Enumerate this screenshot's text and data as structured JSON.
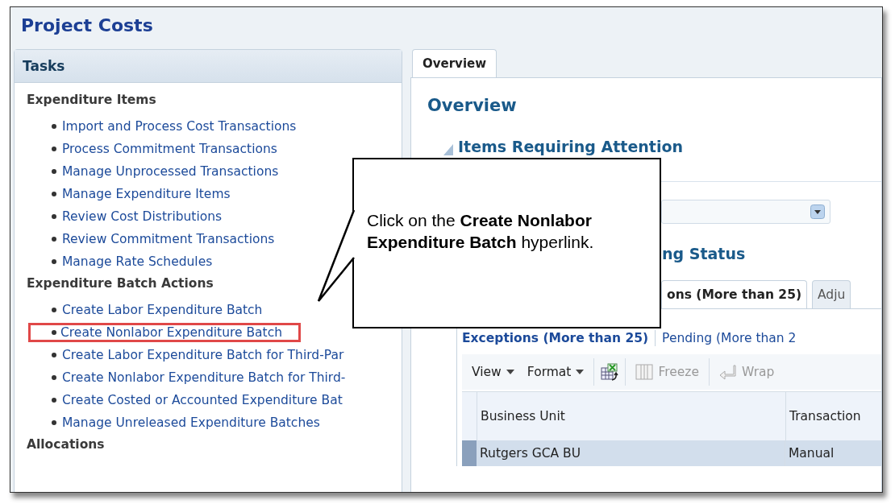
{
  "page_title": "Project Costs",
  "tasks_panel": {
    "title": "Tasks",
    "sections": [
      {
        "heading": "Expenditure Items",
        "links": [
          {
            "label": "Import and Process Cost Transactions",
            "highlighted": false
          },
          {
            "label": "Process Commitment Transactions",
            "highlighted": false
          },
          {
            "label": "Manage Unprocessed Transactions",
            "highlighted": false
          },
          {
            "label": "Manage Expenditure Items",
            "highlighted": false
          },
          {
            "label": "Review Cost Distributions",
            "highlighted": false
          },
          {
            "label": "Review Commitment Transactions",
            "highlighted": false
          },
          {
            "label": "Manage Rate Schedules",
            "highlighted": false
          }
        ]
      },
      {
        "heading": "Expenditure Batch Actions",
        "links": [
          {
            "label": "Create Labor Expenditure Batch",
            "highlighted": false
          },
          {
            "label": "Create Nonlabor Expenditure Batch",
            "highlighted": true
          },
          {
            "label": "Create Labor Expenditure Batch for Third-Par",
            "highlighted": false
          },
          {
            "label": "Create Nonlabor Expenditure Batch for Third-",
            "highlighted": false
          },
          {
            "label": "Create Costed or Accounted Expenditure Bat",
            "highlighted": false
          },
          {
            "label": "Manage Unreleased Expenditure Batches",
            "highlighted": false
          }
        ]
      },
      {
        "heading": "Allocations"
      }
    ]
  },
  "tabs": [
    {
      "label": "Overview",
      "selected": true
    }
  ],
  "overview": {
    "heading": "Overview",
    "section_title": "Items Requiring Attention",
    "status_heading": "ng Status",
    "subtabs": [
      {
        "label": "ons (More than 25)",
        "selected": true
      },
      {
        "label": "Adju",
        "selected": false
      }
    ],
    "filters": [
      {
        "label": "Exceptions (More than 25)",
        "selected": true
      },
      {
        "label": "Pending (More than 2",
        "selected": false
      }
    ],
    "toolbar": [
      {
        "kind": "menu",
        "label": "View"
      },
      {
        "kind": "menu",
        "label": "Format"
      },
      {
        "kind": "export"
      },
      {
        "kind": "freeze",
        "label": "Freeze",
        "disabled": true
      },
      {
        "kind": "wrap",
        "label": "Wrap",
        "disabled": true
      }
    ],
    "table": {
      "columns": [
        "Business Unit",
        "Transaction"
      ],
      "rows": [
        {
          "cells": [
            "Rutgers GCA BU",
            "Manual"
          ],
          "selected": true
        }
      ]
    }
  },
  "callout": {
    "text": "Click on the **Create Nonlabor Expenditure Batch** hyperlink."
  }
}
